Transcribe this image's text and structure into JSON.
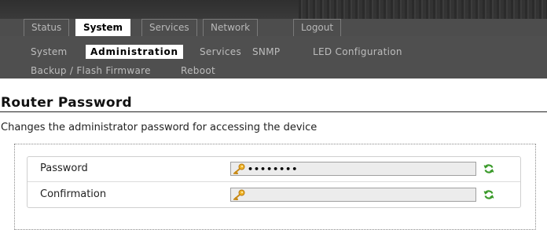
{
  "topnav": {
    "tabs": [
      {
        "label": "Status",
        "active": false
      },
      {
        "label": "System",
        "active": true
      },
      {
        "label": "Services",
        "active": false
      },
      {
        "label": "Network",
        "active": false
      },
      {
        "label": "Logout",
        "active": false
      }
    ]
  },
  "subnav": {
    "items": [
      {
        "label": "System",
        "active": false
      },
      {
        "label": "Administration",
        "active": true
      },
      {
        "label": "Services",
        "active": false
      },
      {
        "label": "SNMP",
        "active": false
      },
      {
        "label": "LED Configuration",
        "active": false
      },
      {
        "label": "Backup / Flash Firmware",
        "active": false
      },
      {
        "label": "Reboot",
        "active": false
      }
    ]
  },
  "page": {
    "title": "Router Password",
    "description": "Changes the administrator password for accessing the device"
  },
  "form": {
    "fields": [
      {
        "label": "Password",
        "value": "••••••••",
        "type": "password"
      },
      {
        "label": "Confirmation",
        "value": "",
        "type": "password"
      }
    ]
  },
  "icons": {
    "key": "key-icon",
    "reveal": "refresh-icon"
  },
  "colors": {
    "header_bg": "#4d4d4d",
    "active_tab_bg": "#ffffff",
    "inactive_text": "#b8b8b8",
    "icon_key": "#e0a020",
    "icon_reveal": "#3a9a2a"
  }
}
